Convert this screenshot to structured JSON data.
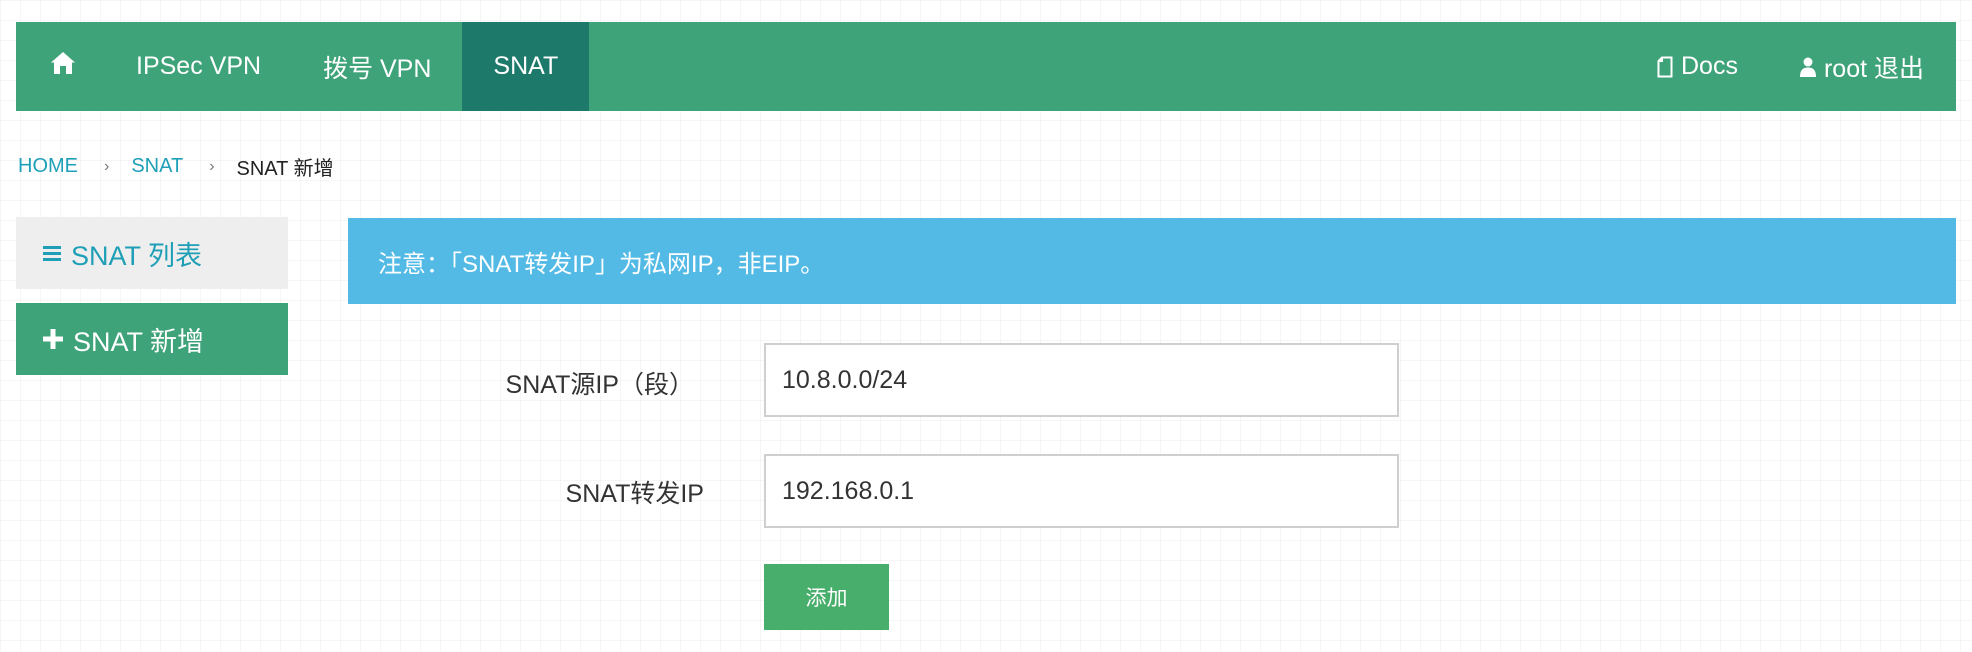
{
  "navbar": {
    "home_icon": "home-icon",
    "items": [
      {
        "label": "IPSec VPN"
      },
      {
        "label": "拨号 VPN"
      },
      {
        "label": "SNAT",
        "active": true
      }
    ],
    "docs": {
      "icon": "document-icon",
      "label": "Docs"
    },
    "user": {
      "icon": "user-icon",
      "label": "root 退出"
    },
    "colors": {
      "bar": "#3fa37a",
      "active": "#1d7a6b"
    }
  },
  "breadcrumb": {
    "items": [
      "HOME",
      "SNAT"
    ],
    "separator": "›",
    "current": "SNAT 新增"
  },
  "sidebar": {
    "list": {
      "icon": "list-icon",
      "label": "SNAT 列表"
    },
    "add": {
      "icon": "plus-icon",
      "label": "SNAT 新增"
    }
  },
  "alert": {
    "text": "注意：「SNAT转发IP」为私网IP，非EIP。",
    "color": "#53bae6"
  },
  "form": {
    "source_ip": {
      "label": "SNAT源IP（段）",
      "value": "10.8.0.0/24"
    },
    "forward_ip": {
      "label": "SNAT转发IP",
      "value": "192.168.0.1"
    },
    "submit_label": "添加",
    "submit_color": "#48ae6b"
  }
}
